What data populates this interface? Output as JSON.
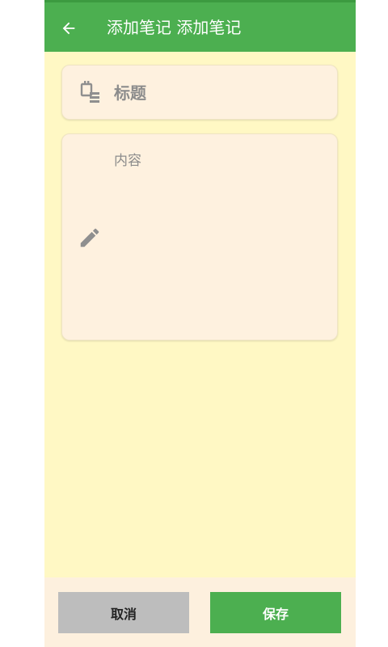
{
  "app_bar": {
    "title": "添加笔记 添加笔记",
    "back_icon": "arrow-left-icon",
    "color": "#4caf50"
  },
  "title_field": {
    "placeholder": "标题",
    "value": "",
    "icon": "title-note-icon"
  },
  "content_field": {
    "placeholder": "内容",
    "value": "",
    "icon": "pencil-icon"
  },
  "actions": {
    "cancel_label": "取消",
    "save_label": "保存"
  },
  "colors": {
    "background": "#fff8c4",
    "card": "#fef1df",
    "accent": "#4caf50",
    "cancel": "#bdbdbd"
  }
}
